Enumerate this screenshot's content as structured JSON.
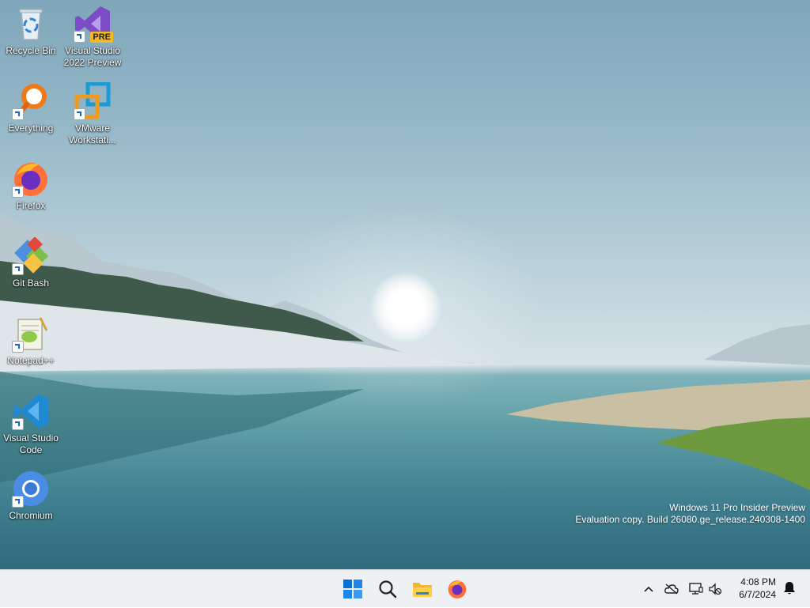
{
  "desktop_icons": [
    {
      "label": "Recycle Bin"
    },
    {
      "label": "Visual Studio 2022 Preview",
      "badge": "PRE"
    },
    {
      "label": "Everything"
    },
    {
      "label": "VMware Workstati..."
    },
    {
      "label": "Firefox"
    },
    {
      "label": "Git Bash"
    },
    {
      "label": "Notepad++"
    },
    {
      "label": "Visual Studio Code"
    },
    {
      "label": "Chromium"
    }
  ],
  "watermark": {
    "line1": "Windows 11 Pro Insider Preview",
    "line2": "Evaluation copy. Build 26080.ge_release.240308-1400"
  },
  "taskbar": {
    "apps": [
      "start-icon",
      "search-icon",
      "file-explorer-icon",
      "firefox-icon"
    ],
    "tray_icons": [
      "chevron-up-icon",
      "onedrive-offline-icon",
      "network-icon",
      "volume-muted-icon",
      "notification-bell-icon"
    ],
    "time": "4:08 PM",
    "date": "6/7/2024"
  },
  "colors": {
    "taskbar_bg": "#eef1f4",
    "windows_blue": "#0078d4",
    "vs_purple": "#7b4cc5",
    "vscode_blue": "#1f8ad2"
  }
}
